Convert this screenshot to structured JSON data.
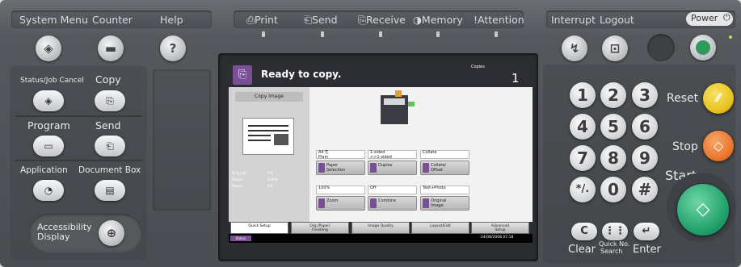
{
  "top_labels": {
    "system_menu": "System Menu",
    "counter": "Counter",
    "help": "Help",
    "print": "Print",
    "send": "Send",
    "receive": "Receive",
    "memory": "Memory",
    "attention": "Attention",
    "interrupt": "Interrupt",
    "logout": "Logout",
    "power": "Power"
  },
  "left_panel": {
    "status_job_cancel": "Status/Job Cancel",
    "copy": "Copy",
    "program": "Program",
    "send": "Send",
    "application": "Application",
    "document_box": "Document Box",
    "accessibility": "Accessibility",
    "display": "Display"
  },
  "screen": {
    "status": "Ready to copy.",
    "copies_label": "Copies",
    "copies_value": "1",
    "copy_image_btn": "Copy Image",
    "original_label": "Original",
    "original_value": "A4",
    "zoom_label": "Zoom",
    "zoom_value": "100%",
    "paper_label": "Paper",
    "paper_value": "A4",
    "settings": [
      {
        "value": "A4 ⎘\nPlain",
        "button": "Paper\nSelection"
      },
      {
        "value": "1-sided\n>>1-sided",
        "button": "Duplex"
      },
      {
        "value": "Collate",
        "button": "Collate/\nOffset"
      },
      {
        "value": "100%",
        "button": "Zoom"
      },
      {
        "value": "Off",
        "button": "Combine"
      },
      {
        "value": "Text+Photo",
        "button": "Original\nImage"
      }
    ],
    "tabs": [
      "Quick Setup",
      "Org./Paper/\nFinishing",
      "Image Quality",
      "Layout/Edit",
      "Advanced\nSetup"
    ],
    "status_btn": "Status",
    "datetime": "24/08/2008   07:18"
  },
  "keypad": {
    "keys": [
      "1",
      "2",
      "3",
      "4",
      "5",
      "6",
      "7",
      "8",
      "9",
      "*/.",
      "0",
      "#"
    ],
    "reset": "Reset",
    "stop": "Stop",
    "start": "Start",
    "clear": "Clear",
    "quick_no_search_1": "Quick No.",
    "quick_no_search_2": "Search",
    "enter": "Enter"
  },
  "colors": {
    "accent_purple": "#7a4f96",
    "reset_yellow": "#e8c21c",
    "stop_orange": "#e9752a",
    "start_green": "#1fa06a",
    "power_green": "#2f9a5a"
  }
}
